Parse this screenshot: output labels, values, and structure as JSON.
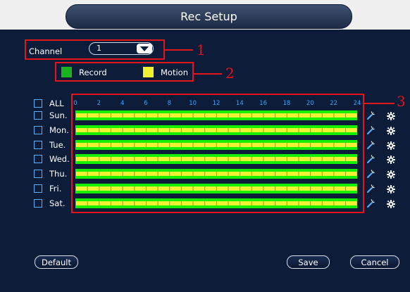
{
  "window": {
    "title": "Rec Setup"
  },
  "channel": {
    "label": "Channel",
    "value": "1"
  },
  "legend": [
    {
      "label": "Record",
      "color": "#19b41f"
    },
    {
      "label": "Motion",
      "color": "#f1f133"
    }
  ],
  "schedule": {
    "all_label": "ALL",
    "hours": [
      "0",
      "2",
      "4",
      "6",
      "8",
      "10",
      "12",
      "14",
      "16",
      "18",
      "20",
      "22",
      "24"
    ],
    "days": [
      {
        "label": "Sun."
      },
      {
        "label": "Mon."
      },
      {
        "label": "Tue."
      },
      {
        "label": "Wed."
      },
      {
        "label": "Thu."
      },
      {
        "label": "Fri."
      },
      {
        "label": "Sat."
      }
    ],
    "record_color": "#18ee00",
    "motion_color": "#f1f133"
  },
  "annotations": [
    "1",
    "2",
    "3"
  ],
  "buttons": {
    "default": "Default",
    "save": "Save",
    "cancel": "Cancel"
  }
}
